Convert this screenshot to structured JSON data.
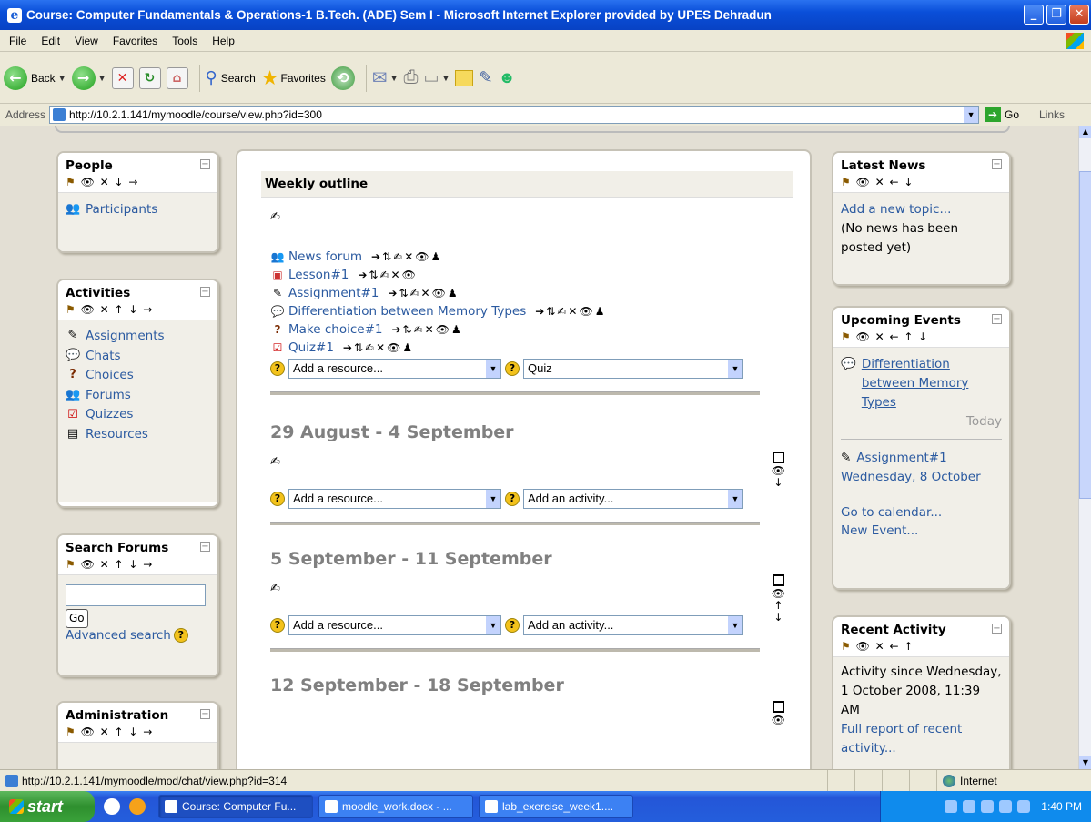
{
  "window": {
    "title": "Course: Computer Fundamentals & Operations-1 B.Tech. (ADE) Sem I - Microsoft Internet Explorer provided by UPES Dehradun"
  },
  "menu": [
    "File",
    "Edit",
    "View",
    "Favorites",
    "Tools",
    "Help"
  ],
  "toolbar": {
    "back": "Back",
    "search": "Search",
    "favorites": "Favorites"
  },
  "address": {
    "label": "Address",
    "url": "http://10.2.1.141/mymoodle/course/view.php?id=300",
    "go": "Go",
    "links": "Links"
  },
  "blocks": {
    "people": {
      "title": "People",
      "items": [
        "Participants"
      ]
    },
    "activities": {
      "title": "Activities",
      "items": [
        "Assignments",
        "Chats",
        "Choices",
        "Forums",
        "Quizzes",
        "Resources"
      ]
    },
    "search": {
      "title": "Search Forums",
      "go": "Go",
      "advanced": "Advanced search"
    },
    "admin": {
      "title": "Administration"
    },
    "news": {
      "title": "Latest News",
      "add": "Add a new topic...",
      "empty": "(No news has been posted yet)"
    },
    "events": {
      "title": "Upcoming Events",
      "event1": "Differentiation between Memory Types",
      "event1_when": "Today",
      "event2": "Assignment#1",
      "event2_when": "Wednesday, 8 October",
      "calendar": "Go to calendar...",
      "new_event": "New Event..."
    },
    "recent": {
      "title": "Recent Activity",
      "since": "Activity since Wednesday, 1 October 2008, 11:39 AM",
      "full": "Full report of recent activity..."
    }
  },
  "course": {
    "outline_title": "Weekly outline",
    "activities": [
      "News forum",
      "Lesson#1",
      "Assignment#1",
      "Differentiation between Memory Types",
      "Make choice#1",
      "Quiz#1"
    ],
    "add_resource": "Add a resource...",
    "quiz_option": "Quiz",
    "add_activity": "Add an activity...",
    "weeks": [
      "29 August - 4 September",
      "5 September - 11 September",
      "12 September - 18 September"
    ]
  },
  "status": {
    "url": "http://10.2.1.141/mymoodle/mod/chat/view.php?id=314",
    "zone": "Internet"
  },
  "taskbar": {
    "start": "start",
    "tasks": [
      "Course: Computer Fu...",
      "moodle_work.docx - ...",
      "lab_exercise_week1...."
    ],
    "clock": "1:40 PM"
  }
}
